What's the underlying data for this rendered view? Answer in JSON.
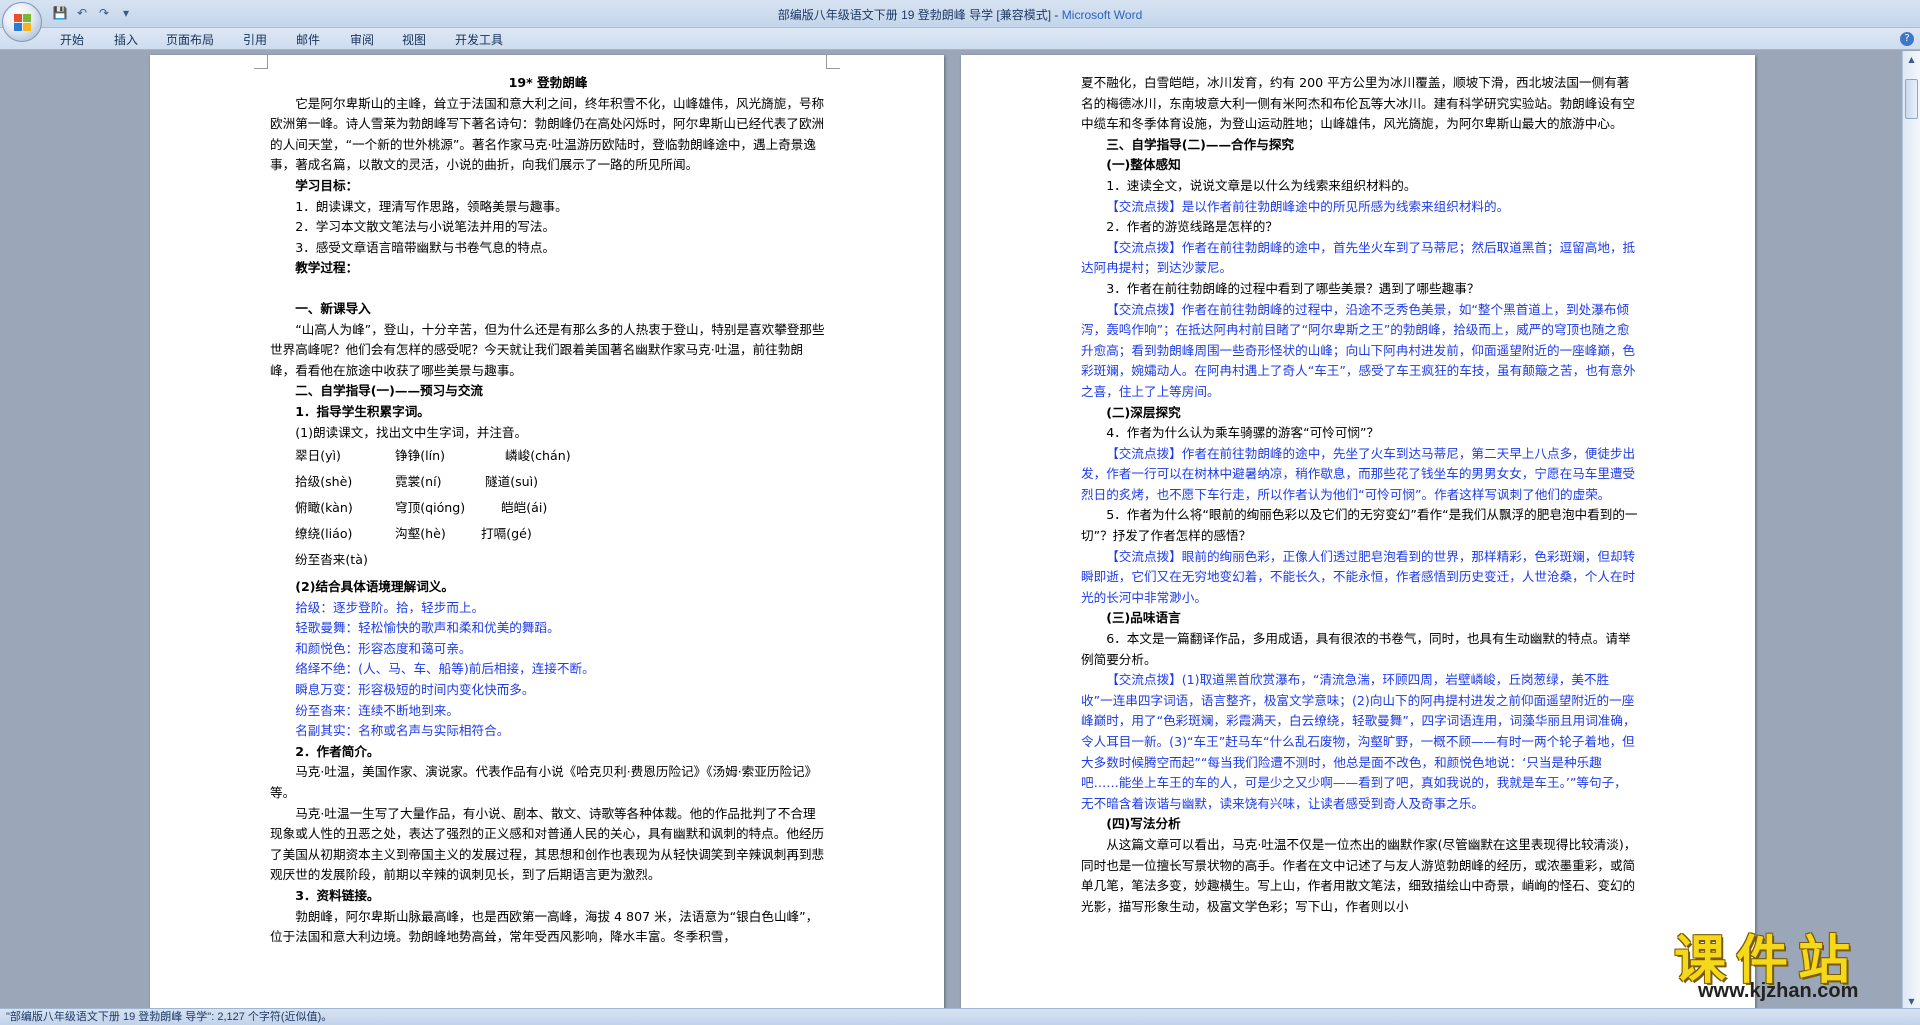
{
  "window": {
    "title": "部编版八年级语文下册 19 登勃朗峰  导学 [兼容模式] - ",
    "app_name": "Microsoft Word"
  },
  "quick_access": {
    "icons": [
      "save-icon",
      "undo-icon",
      "redo-icon",
      "customize-icon"
    ]
  },
  "ribbon": {
    "tabs": [
      "开始",
      "插入",
      "页面布局",
      "引用",
      "邮件",
      "审阅",
      "视图",
      "开发工具"
    ]
  },
  "status_bar": {
    "text": "\"部编版八年级语文下册 19 登勃朗峰  导学\": 2,127 个字符(近似值)。"
  },
  "watermark": {
    "text": "课件站",
    "url": "www.kjzhan.com"
  },
  "left_page": {
    "title": "19* 登勃朗峰",
    "intro": "它是阿尔卑斯山的主峰，耸立于法国和意大利之间，终年积雪不化，山峰雄伟，风光旖旎，号称欧洲第一峰。诗人雪莱为勃朗峰写下著名诗句：勃朗峰仍在高处闪烁时，阿尔卑斯山已经代表了欧洲的人间天堂，“一个新的世外桃源”。著名作家马克·吐温游历欧陆时，登临勃朗峰途中，遇上奇景逸事，著成名篇，以散文的灵活，小说的曲折，向我们展示了一路的所见所闻。",
    "goals_head": "学习目标：",
    "goals": [
      "1．朗读课文，理清写作思路，领略美景与趣事。",
      "2．学习本文散文笔法与小说笔法并用的写法。",
      "3．感受文章语言暗带幽默与书卷气息的特点。"
    ],
    "process_head": "教学过程：",
    "sec1_head": "一、新课导入",
    "sec1_text": "“山高人为峰”，登山，十分辛苦，但为什么还是有那么多的人热衷于登山，特别是喜欢攀登那些世界高峰呢？他们会有怎样的感受呢？今天就让我们跟着美国著名幽默作家马克·吐温，前往勃朗峰，看看他在旅途中收获了哪些美景与趣事。",
    "sec2_head": "二、自学指导(一)——预习与交流",
    "sub1_head": "1．指导学生积累字词。",
    "sub1_intro": "(1)朗读课文，找出文中生字词，并注音。",
    "pinyin_rows": [
      [
        "翠日(yì)",
        "铮铮(lín)",
        "嶙峻(chán)"
      ],
      [
        "拾级(shè)",
        "霓裳(ní)",
        "隧道(suì)"
      ],
      [
        "俯瞰(kàn)",
        "穹顶(qióng)",
        "皑皑(ái)"
      ],
      [
        "缭绕(liáo)",
        "沟壑(hè)",
        "打嗝(gé)"
      ],
      [
        "纷至沓来(tà)"
      ]
    ],
    "sub2_head": "(2)结合具体语境理解词义。",
    "vocab": [
      "拾级：逐步登阶。拾，轻步而上。",
      "轻歌曼舞：轻松愉快的歌声和柔和优美的舞蹈。",
      "和颜悦色：形容态度和蔼可亲。",
      "络绎不绝：(人、马、车、船等)前后相接，连接不断。",
      "瞬息万变：形容极短的时间内变化快而多。",
      "纷至沓来：连续不断地到来。",
      "名副其实：名称或名声与实际相符合。"
    ],
    "sub3_head": "2．作者简介。",
    "author_p1": "马克·吐温，美国作家、演说家。代表作品有小说《哈克贝利·费恩历险记》《汤姆·索亚历险记》等。",
    "author_p2": "马克·吐温一生写了大量作品，有小说、剧本、散文、诗歌等各种体裁。他的作品批判了不合理现象或人性的丑恶之处，表达了强烈的正义感和对普通人民的关心，具有幽默和讽刺的特点。他经历了美国从初期资本主义到帝国主义的发展过程，其思想和创作也表现为从轻快调笑到辛辣讽刺再到悲观厌世的发展阶段，前期以辛辣的讽刺见长，到了后期语言更为激烈。",
    "sub4_head": "3．资料链接。",
    "info_p": "勃朗峰，阿尔卑斯山脉最高峰，也是西欧第一高峰，海拔 4 807 米，法语意为“银白色山峰”，位于法国和意大利边境。勃朗峰地势高耸，常年受西风影响，降水丰富。冬季积雪，"
  },
  "right_page": {
    "cont_p": "夏不融化，白雪皑皑，冰川发育，约有 200 平方公里为冰川覆盖，顺坡下滑，西北坡法国一侧有著名的梅德冰川，东南坡意大利一侧有米阿杰和布伦瓦等大冰川。建有科学研究实验站。勃朗峰设有空中缆车和冬季体育设施，为登山运动胜地；山峰雄伟，风光旖旎，为阿尔卑斯山最大的旅游中心。",
    "sec3_head": "三、自学指导(二)——合作与探究",
    "part1_head": "(一)整体感知",
    "q1": "1．速读全文，说说文章是以什么为线索来组织材料的。",
    "a1": "【交流点拨】是以作者前往勃朗峰途中的所见所感为线索来组织材料的。",
    "q2": "2．作者的游览线路是怎样的？",
    "a2": "【交流点拨】作者在前往勃朗峰的途中，首先坐火车到了马蒂尼；然后取道黑首；逗留高地，抵达阿冉提村；到达沙蒙尼。",
    "q3": "3．作者在前往勃朗峰的过程中看到了哪些美景？遇到了哪些趣事？",
    "a3": "【交流点拨】作者在前往勃朗峰的过程中，沿途不乏秀色美景，如“整个黑首道上，到处瀑布倾泻，轰鸣作响”；在抵达阿冉村前目睹了“阿尔卑斯之王”的勃朗峰，拾级而上，威严的穹顶也随之愈升愈高；看到勃朗峰周围一些奇形怪状的山峰；向山下阿冉村进发前，仰面遥望附近的一座峰巅，色彩斑斓，婉孀动人。在阿冉村遇上了奇人“车王”，感受了车王疯狂的车技，虽有颠簸之苦，也有意外之喜，住上了上等房间。",
    "part2_head": "(二)深层探究",
    "q4": "4．作者为什么认为乘车骑骡的游客“可怜可悯”？",
    "a4": "【交流点拨】作者在前往勃朗峰的途中，先坐了火车到达马蒂尼，第二天早上八点多，便徒步出发，作者一行可以在树林中避暑纳凉，稍作歇息，而那些花了钱坐车的男男女女，宁愿在马车里遭受烈日的炙烤，也不愿下车行走，所以作者认为他们“可怜可悯”。作者这样写讽刺了他们的虚荣。",
    "q5": "5．作者为什么将“眼前的绚丽色彩以及它们的无穷变幻”看作“是我们从飘浮的肥皂泡中看到的一切”？抒发了作者怎样的感悟？",
    "a5": "【交流点拨】眼前的绚丽色彩，正像人们透过肥皂泡看到的世界，那样精彩，色彩斑斓，但却转瞬即逝，它们又在无穷地变幻着，不能长久，不能永恒，作者感悟到历史变迁，人世沧桑，个人在时光的长河中非常渺小。",
    "part3_head": "(三)品味语言",
    "q6": "6．本文是一篇翻译作品，多用成语，具有很浓的书卷气，同时，也具有生动幽默的特点。请举例简要分析。",
    "a6": "【交流点拨】(1)取道黑首欣赏瀑布，“清流急湍，环顾四周，岩壁嶙峻，丘岗葱绿，美不胜收”一连串四字词语，语言整齐，极富文学意味；(2)向山下的阿冉提村进发之前仰面遥望附近的一座峰巅时，用了“色彩斑斓，彩霞满天，白云缭绕，轻歌曼舞”，四字词语连用，词藻华丽且用词准确，令人耳目一新。(3)“车王”赶马车“什么乱石废物，沟壑旷野，一概不顾——有时一两个轮子着地，但大多数时候腾空而起”“每当我们险遭不测时，他总是面不改色，和颜悦色地说：‘只当是种乐趣吧……能坐上车王的车的人，可是少之又少啊——看到了吧，真如我说的，我就是车王。’”等句子，无不暗含着诙谐与幽默，读来饶有兴味，让读者感受到奇人及奇事之乐。",
    "part4_head": "(四)写法分析",
    "w_p": "从这篇文章可以看出，马克·吐温不仅是一位杰出的幽默作家(尽管幽默在这里表现得比较清淡)，同时也是一位擅长写景状物的高手。作者在文中记述了与友人游览勃朗峰的经历，或浓墨重彩，或简单几笔，笔法多变，妙趣横生。写上山，作者用散文笔法，细致描绘山中奇景，峭峋的怪石、变幻的光影，描写形象生动，极富文学色彩；写下山，作者则以小"
  }
}
